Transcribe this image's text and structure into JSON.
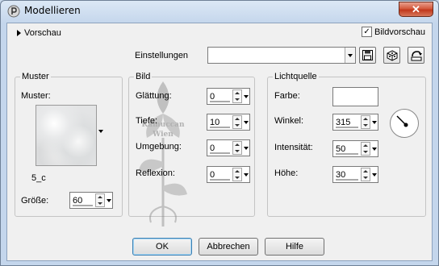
{
  "window": {
    "title": "Modellieren",
    "close_glyph": "✕"
  },
  "preview": {
    "toggle_label": "Vorschau",
    "image_preview_label": "Bildvorschau",
    "image_preview_checked": true
  },
  "settings": {
    "label": "Einstellungen",
    "value": ""
  },
  "watermark": {
    "line1": "Kamuccan",
    "line2": "Wien"
  },
  "muster": {
    "group_label": "Muster",
    "field_label": "Muster:",
    "pattern_name": "5_c",
    "size_label": "Größe:",
    "size_value": "60"
  },
  "bild": {
    "group_label": "Bild",
    "glaettung_label": "Glättung:",
    "glaettung_value": "0",
    "tiefe_label": "Tiefe:",
    "tiefe_value": "10",
    "umgebung_label": "Umgebung:",
    "umgebung_value": "0",
    "reflexion_label": "Reflexion:",
    "reflexion_value": "0"
  },
  "licht": {
    "group_label": "Lichtquelle",
    "farbe_label": "Farbe:",
    "farbe_color": "#ffffff",
    "winkel_label": "Winkel:",
    "winkel_value": "315",
    "intensitaet_label": "Intensität:",
    "intensitaet_value": "50",
    "hoehe_label": "Höhe:",
    "hoehe_value": "30"
  },
  "buttons": {
    "ok": "OK",
    "cancel": "Abbrechen",
    "help": "Hilfe"
  },
  "icons": {
    "app": "psp-app-icon",
    "save": "save-icon",
    "reset": "cube-reset-icon",
    "presets": "preset-options-icon",
    "dial": "light-direction-dial-icon"
  }
}
